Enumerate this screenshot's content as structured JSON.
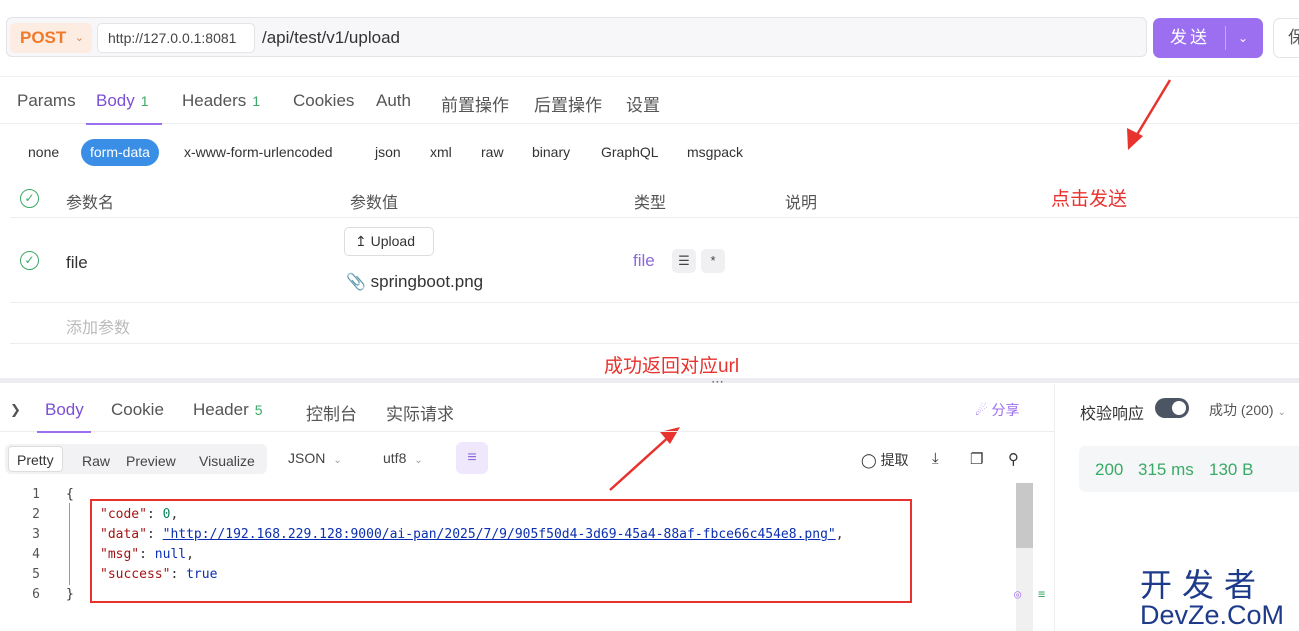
{
  "request": {
    "method": "POST",
    "host": "http://127.0.0.1:8081",
    "path": "/api/test/v1/upload",
    "send_label": "发送",
    "save_label": "保"
  },
  "tabs": [
    {
      "label": "Params"
    },
    {
      "label": "Body",
      "badge": "1"
    },
    {
      "label": "Headers",
      "badge": "1"
    },
    {
      "label": "Cookies"
    },
    {
      "label": "Auth"
    },
    {
      "label": "前置操作"
    },
    {
      "label": "后置操作"
    },
    {
      "label": "设置"
    }
  ],
  "body_types": [
    "none",
    "form-data",
    "x-www-form-urlencoded",
    "json",
    "xml",
    "raw",
    "binary",
    "GraphQL",
    "msgpack"
  ],
  "params_table": {
    "headers": [
      "参数名",
      "参数值",
      "类型",
      "说明"
    ],
    "rows": [
      {
        "name": "file",
        "upload_label": "Upload",
        "filename": "springboot.png",
        "type": "file",
        "required_mark": "*"
      }
    ],
    "add_placeholder": "添加参数"
  },
  "annotations": {
    "click_send": "点击发送",
    "success_url": "成功返回对应url"
  },
  "response": {
    "tabs": [
      {
        "label": "Body"
      },
      {
        "label": "Cookie"
      },
      {
        "label": "Header",
        "badge": "5"
      },
      {
        "label": "控制台"
      },
      {
        "label": "实际请求"
      }
    ],
    "share_label": "分享",
    "views": [
      "Pretty",
      "Raw",
      "Preview",
      "Visualize"
    ],
    "format": "JSON",
    "encoding": "utf8",
    "extract_label": "提取",
    "validate_label": "校验响应",
    "status_select": "成功 (200)",
    "status_code": "200",
    "time": "315 ms",
    "size": "130 B",
    "code_lines": [
      "1",
      "2",
      "3",
      "4",
      "5",
      "6"
    ],
    "json": {
      "open": "{",
      "code_key": "\"code\"",
      "code_val": "0",
      "data_key": "\"data\"",
      "data_val": "\"http://192.168.229.128:9000/ai-pan/2025/7/9/905f50d4-3d69-45a4-88af-fbce66c454e8.png\"",
      "msg_key": "\"msg\"",
      "msg_val": "null",
      "success_key": "\"success\"",
      "success_val": "true",
      "close": "}"
    }
  },
  "watermark": {
    "line1": "开发者",
    "line2": "DevZe.CoM"
  }
}
